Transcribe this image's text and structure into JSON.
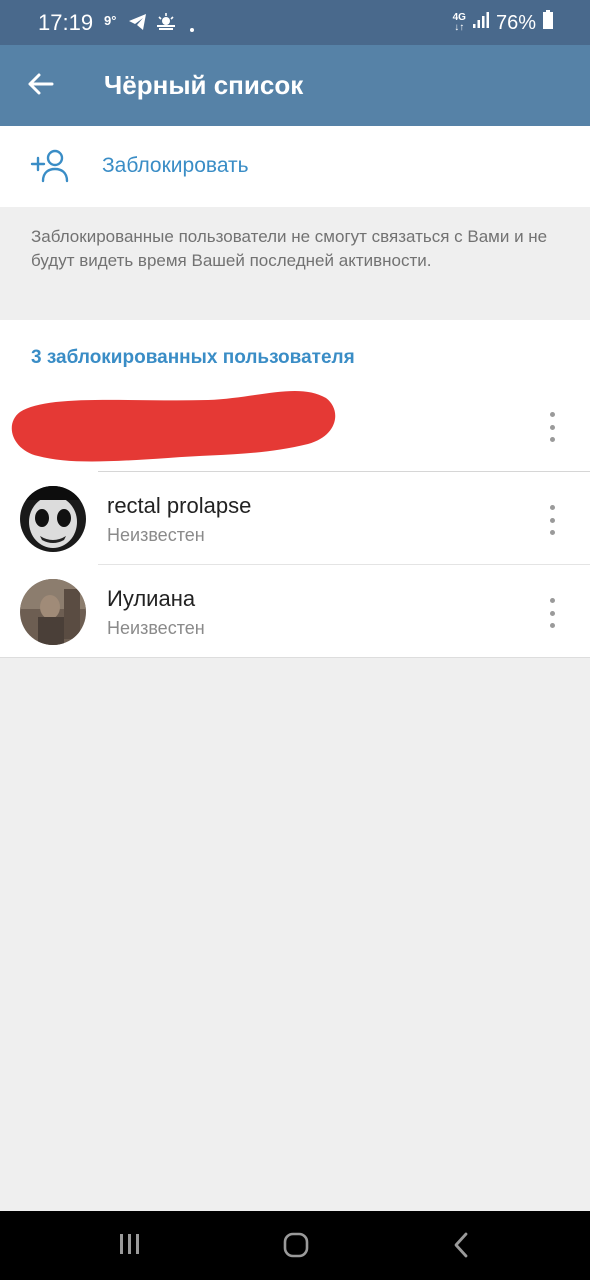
{
  "status_bar": {
    "time": "17:19",
    "temperature": "9°",
    "network_top": "4G",
    "network_bottom": "↓↑",
    "battery": "76%"
  },
  "app_bar": {
    "title": "Чёрный список"
  },
  "block_action": {
    "label": "Заблокировать"
  },
  "info": {
    "text": "Заблокированные пользователи не смогут связаться с Вами и не будут видеть время Вашей последней активности."
  },
  "blocked_list": {
    "header": "3 заблокированных пользователя",
    "users": [
      {
        "name": "",
        "status": ""
      },
      {
        "name": "rectal prolapse",
        "status": "Неизвестен"
      },
      {
        "name": "Иулиана",
        "status": "Неизвестен"
      }
    ]
  },
  "colors": {
    "status_bar": "#49698c",
    "app_bar": "#5682a7",
    "accent": "#3a8dc6",
    "redaction": "#e53935"
  }
}
